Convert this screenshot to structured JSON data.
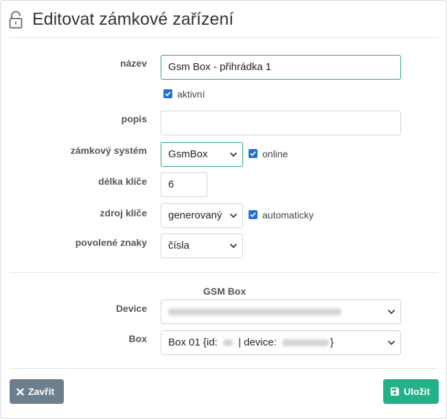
{
  "dialog": {
    "title": "Editovat zámkové zařízení",
    "icon": "unlock-icon"
  },
  "form": {
    "name_label": "název",
    "name_value": "Gsm Box - přihrádka 1",
    "active_label": "aktivní",
    "active_checked": true,
    "description_label": "popis",
    "description_value": "",
    "lock_system_label": "zámkový systém",
    "lock_system_value": "GsmBox",
    "online_label": "online",
    "online_checked": true,
    "key_length_label": "délka klíče",
    "key_length_value": "6",
    "key_source_label": "zdroj klíče",
    "key_source_value": "generovaný",
    "automatic_label": "automaticky",
    "automatic_checked": true,
    "allowed_chars_label": "povolené znaky",
    "allowed_chars_value": "čísla"
  },
  "gsm_box": {
    "section_title": "GSM Box",
    "device_label": "Device",
    "box_label": "Box",
    "box_value_prefix": "Box 01 {id:",
    "box_value_middle": "| device:",
    "box_value_suffix": "}"
  },
  "buttons": {
    "close_label": "Zavřít",
    "save_label": "Uložit"
  },
  "colors": {
    "focus_border": "#2aa583",
    "checkbox": "#1f6fd8",
    "close_button": "#6d7e8f",
    "save_button": "#23b189"
  }
}
